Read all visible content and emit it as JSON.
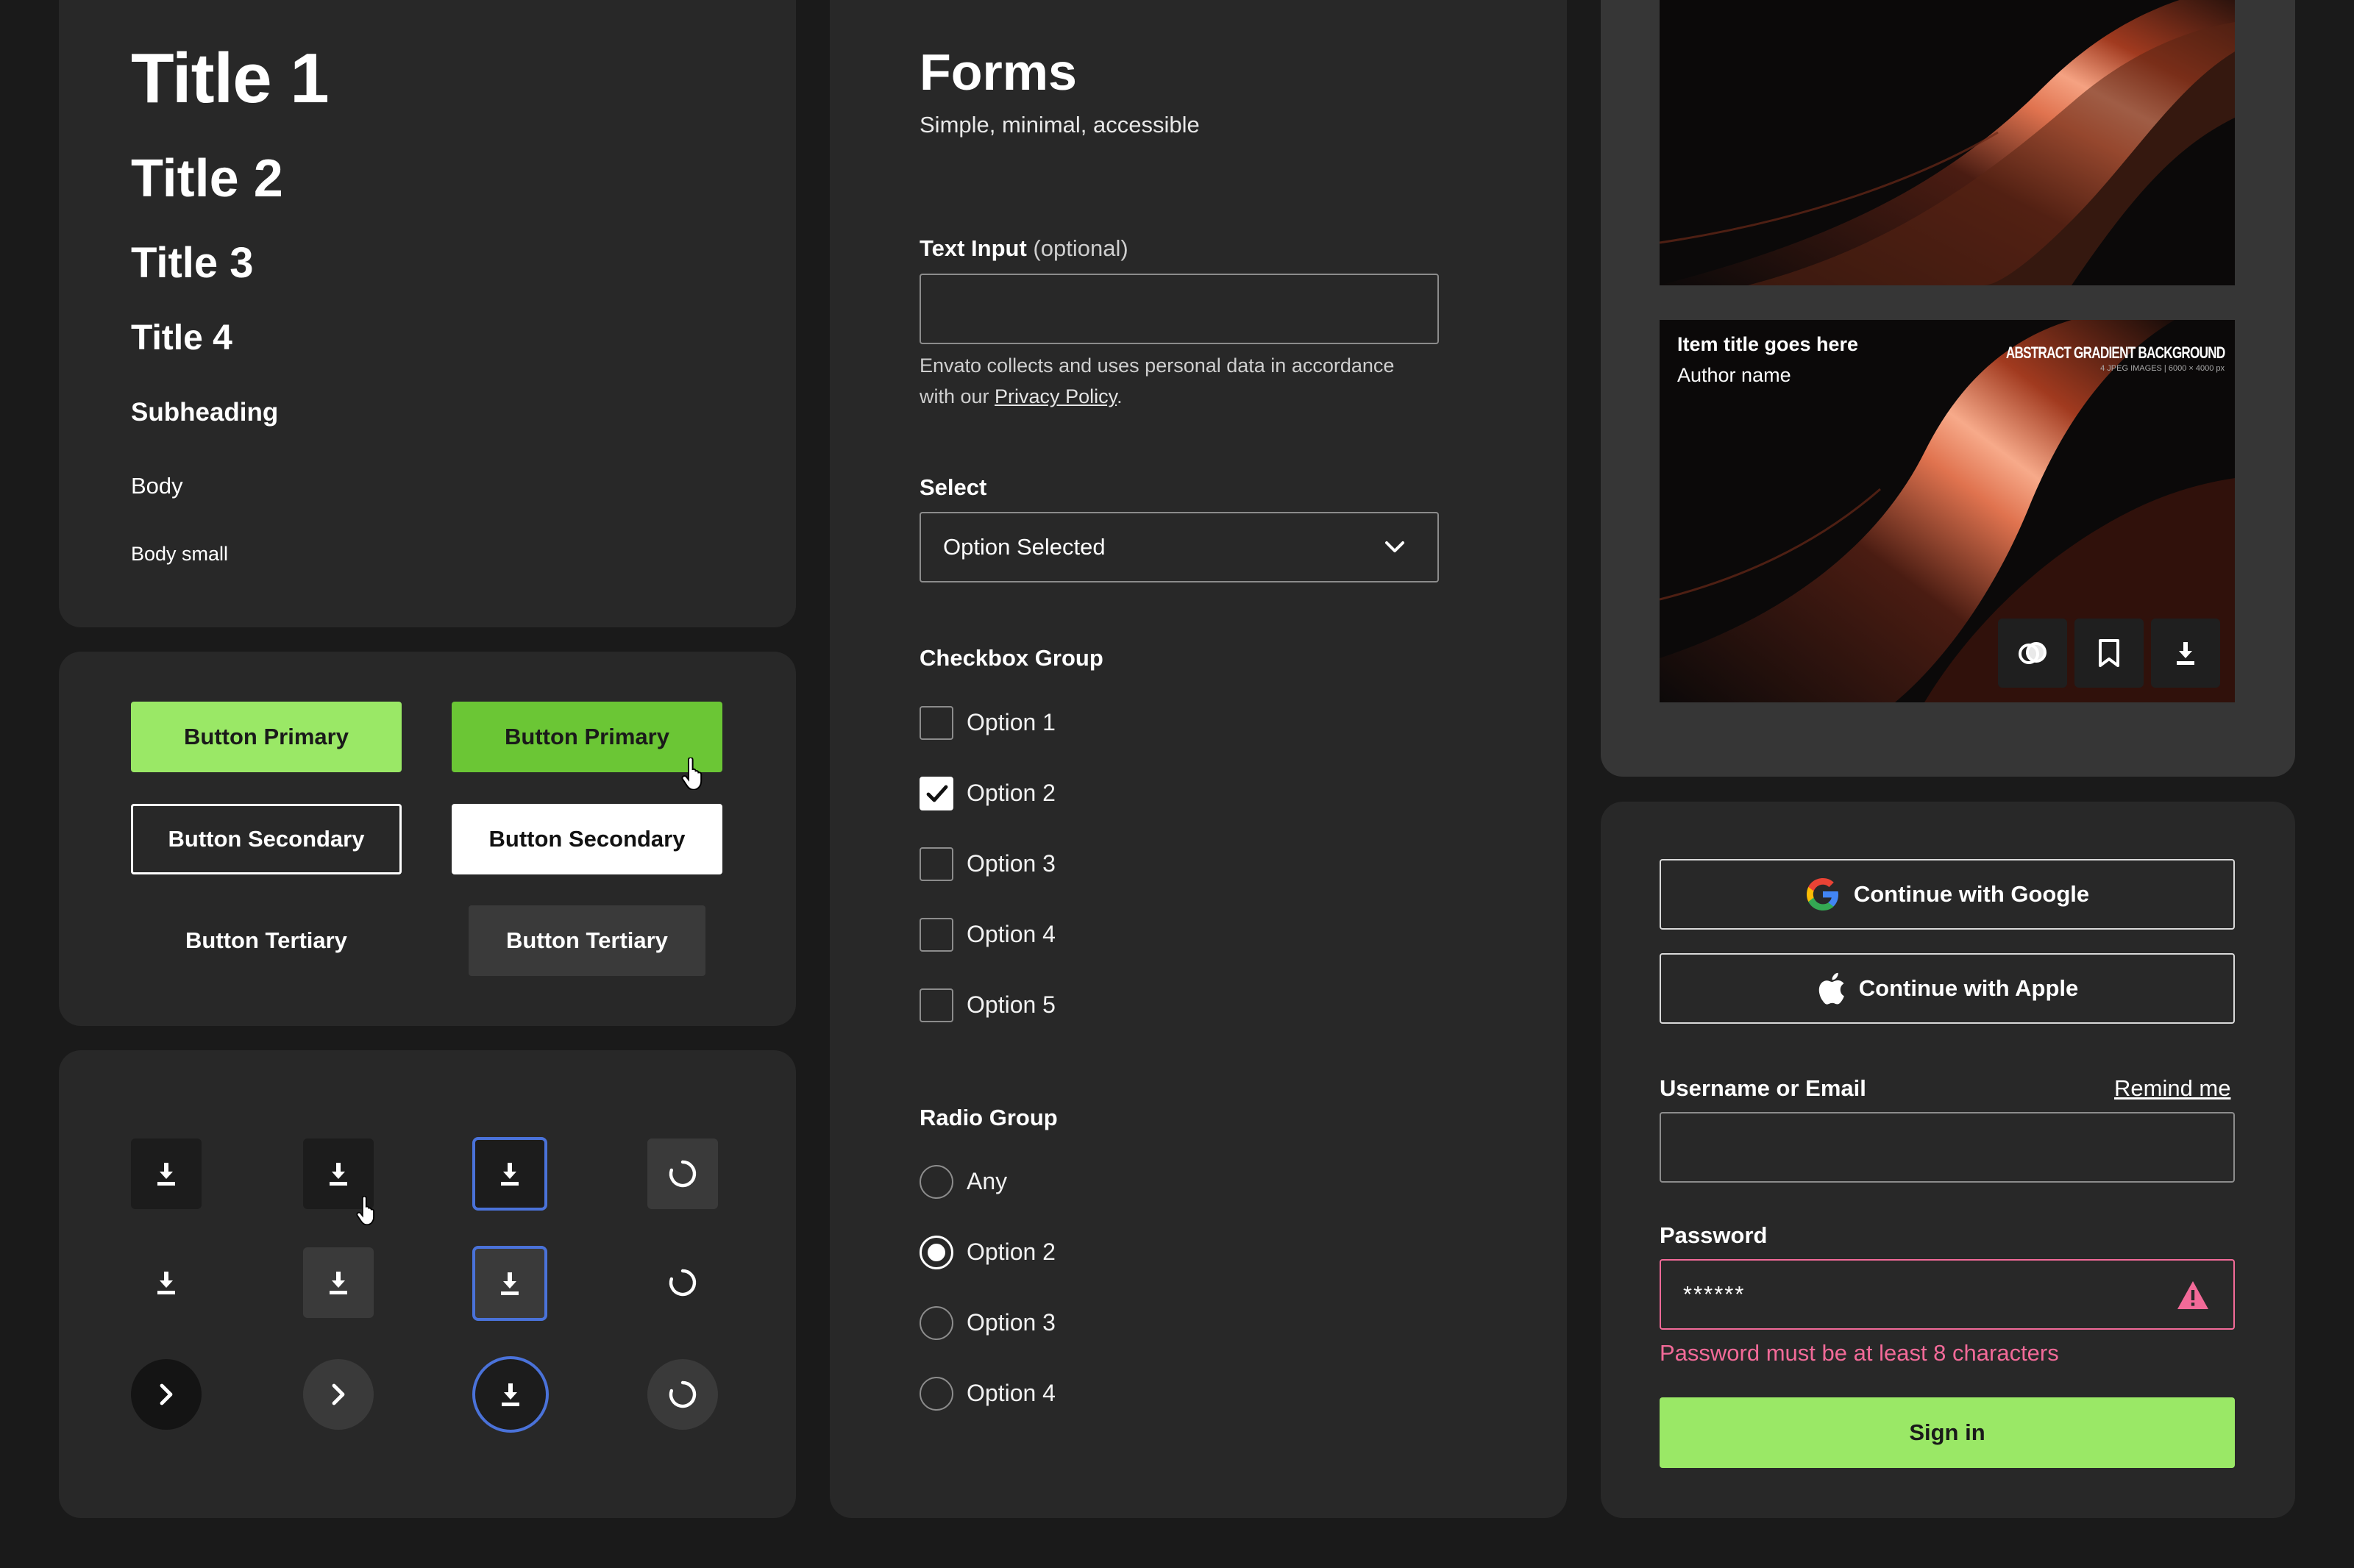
{
  "typography": {
    "title1": "Title 1",
    "title2": "Title 2",
    "title3": "Title 3",
    "title4": "Title 4",
    "subheading": "Subheading",
    "body": "Body",
    "body_small": "Body small"
  },
  "buttons": {
    "primary": "Button Primary",
    "secondary": "Button Secondary",
    "tertiary": "Button Tertiary"
  },
  "icon_buttons": {
    "icons": [
      "download-icon",
      "chevron-right-icon",
      "spinner-icon",
      "cursor-hand-icon"
    ],
    "colors": {
      "dark": "#1c1c1c",
      "mid": "#3a3a3a",
      "focus": "#4a72d9"
    }
  },
  "forms": {
    "title": "Forms",
    "subtitle": "Simple, minimal, accessible",
    "text_input": {
      "label": "Text Input",
      "optional": "(optional)",
      "value": "",
      "helper_pre": "Envato collects and uses personal data in accordance",
      "helper_mid": "with our ",
      "helper_link": "Privacy Policy",
      "helper_post": "."
    },
    "select": {
      "label": "Select",
      "value": "Option Selected"
    },
    "checkbox_group": {
      "label": "Checkbox Group",
      "options": [
        {
          "label": "Option 1",
          "checked": false
        },
        {
          "label": "Option 2",
          "checked": true
        },
        {
          "label": "Option 3",
          "checked": false
        },
        {
          "label": "Option 4",
          "checked": false
        },
        {
          "label": "Option 5",
          "checked": false
        }
      ]
    },
    "radio_group": {
      "label": "Radio Group",
      "options": [
        {
          "label": "Any",
          "selected": false
        },
        {
          "label": "Option 2",
          "selected": true
        },
        {
          "label": "Option 3",
          "selected": false
        },
        {
          "label": "Option 4",
          "selected": false
        }
      ]
    }
  },
  "item_card": {
    "title": "Item title goes here",
    "author": "Author name",
    "art_title": "ABSTRACT GRADIENT BACKGROUND",
    "art_subtitle": "4 JPEG IMAGES | 6000 × 4000 px",
    "actions": [
      "compare-icon",
      "bookmark-icon",
      "download-icon"
    ]
  },
  "auth": {
    "google": "Continue with Google",
    "apple": "Continue with Apple",
    "username_label": "Username or Email",
    "remind": "Remind me",
    "username_value": "",
    "password_label": "Password",
    "password_value": "******",
    "password_error": "Password must be at least 8 characters",
    "sign_in": "Sign in",
    "colors": {
      "error": "#f26a98",
      "primary": "#9ae866"
    }
  }
}
